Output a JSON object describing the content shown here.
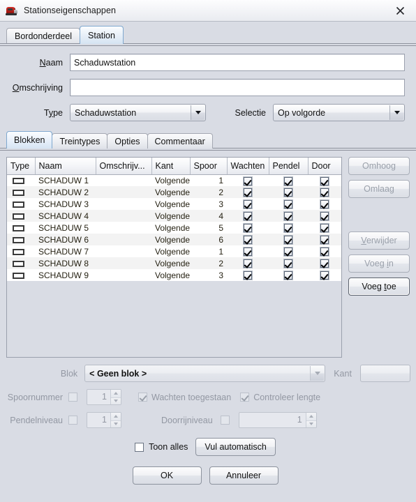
{
  "window": {
    "title": "Stationseigenschappen",
    "icon": "locomotive-icon",
    "close_label": "close-icon"
  },
  "outer_tabs": [
    {
      "label": "Bordonderdeel",
      "selected": false
    },
    {
      "label": "Station",
      "selected": true
    }
  ],
  "form": {
    "naam_label": "Naam",
    "naam_value": "Schaduwstation",
    "omschrijving_label": "Omschrijving",
    "omschrijving_value": "",
    "type_label": "Type",
    "type_value": "Schaduwstation",
    "selectie_label": "Selectie",
    "selectie_value": "Op volgorde"
  },
  "inner_tabs": [
    {
      "label": "Blokken",
      "selected": true
    },
    {
      "label": "Treintypes",
      "selected": false
    },
    {
      "label": "Opties",
      "selected": false
    },
    {
      "label": "Commentaar",
      "selected": false
    }
  ],
  "table": {
    "columns": [
      "Type",
      "Naam",
      "Omschrijv...",
      "Kant",
      "Spoor",
      "Wachten",
      "Pendel",
      "Door"
    ],
    "rows": [
      {
        "type": "block",
        "naam": "SCHADUW 1",
        "omschrijving": "",
        "kant": "Volgende",
        "spoor": "1",
        "wachten": true,
        "pendel": true,
        "door": true
      },
      {
        "type": "block",
        "naam": "SCHADUW 2",
        "omschrijving": "",
        "kant": "Volgende",
        "spoor": "2",
        "wachten": true,
        "pendel": true,
        "door": true
      },
      {
        "type": "block",
        "naam": "SCHADUW 3",
        "omschrijving": "",
        "kant": "Volgende",
        "spoor": "3",
        "wachten": true,
        "pendel": true,
        "door": true
      },
      {
        "type": "block",
        "naam": "SCHADUW 4",
        "omschrijving": "",
        "kant": "Volgende",
        "spoor": "4",
        "wachten": true,
        "pendel": true,
        "door": true
      },
      {
        "type": "block",
        "naam": "SCHADUW 5",
        "omschrijving": "",
        "kant": "Volgende",
        "spoor": "5",
        "wachten": true,
        "pendel": true,
        "door": true
      },
      {
        "type": "block",
        "naam": "SCHADUW 6",
        "omschrijving": "",
        "kant": "Volgende",
        "spoor": "6",
        "wachten": true,
        "pendel": true,
        "door": true
      },
      {
        "type": "block",
        "naam": "SCHADUW 7",
        "omschrijving": "",
        "kant": "Volgende",
        "spoor": "1",
        "wachten": true,
        "pendel": true,
        "door": true
      },
      {
        "type": "block",
        "naam": "SCHADUW 8",
        "omschrijving": "",
        "kant": "Volgende",
        "spoor": "2",
        "wachten": true,
        "pendel": true,
        "door": true
      },
      {
        "type": "block",
        "naam": "SCHADUW 9",
        "omschrijving": "",
        "kant": "Volgende",
        "spoor": "3",
        "wachten": true,
        "pendel": true,
        "door": true
      }
    ]
  },
  "side_buttons": [
    {
      "label": "Omhoog",
      "enabled": false
    },
    {
      "label": "Omlaag",
      "enabled": false
    },
    {
      "label": "Verwijder",
      "enabled": false
    },
    {
      "label": "Voeg in",
      "enabled": false
    },
    {
      "label": "Voeg toe",
      "enabled": true
    }
  ],
  "lower": {
    "blok_label": "Blok",
    "blok_value": "< Geen blok >",
    "kant_label": "Kant",
    "kant_value": "",
    "spoornummer_label": "Spoornummer",
    "spoornummer_checked": false,
    "spoornummer_value": "1",
    "wachten_toegestaan_label": "Wachten toegestaan",
    "wachten_toegestaan_checked": true,
    "controleer_lengte_label": "Controleer lengte",
    "controleer_lengte_checked": true,
    "pendelniveau_label": "Pendelniveau",
    "pendelniveau_checked": false,
    "pendelniveau_value": "1",
    "doorrijniveau_label": "Doorrijniveau",
    "doorrijniveau_checked": false,
    "doorrijniveau_value": "1",
    "toon_alles_label": "Toon alles",
    "toon_alles_checked": false,
    "vul_automatisch_label": "Vul automatisch"
  },
  "footer": {
    "ok_label": "OK",
    "cancel_label": "Annuleer"
  }
}
